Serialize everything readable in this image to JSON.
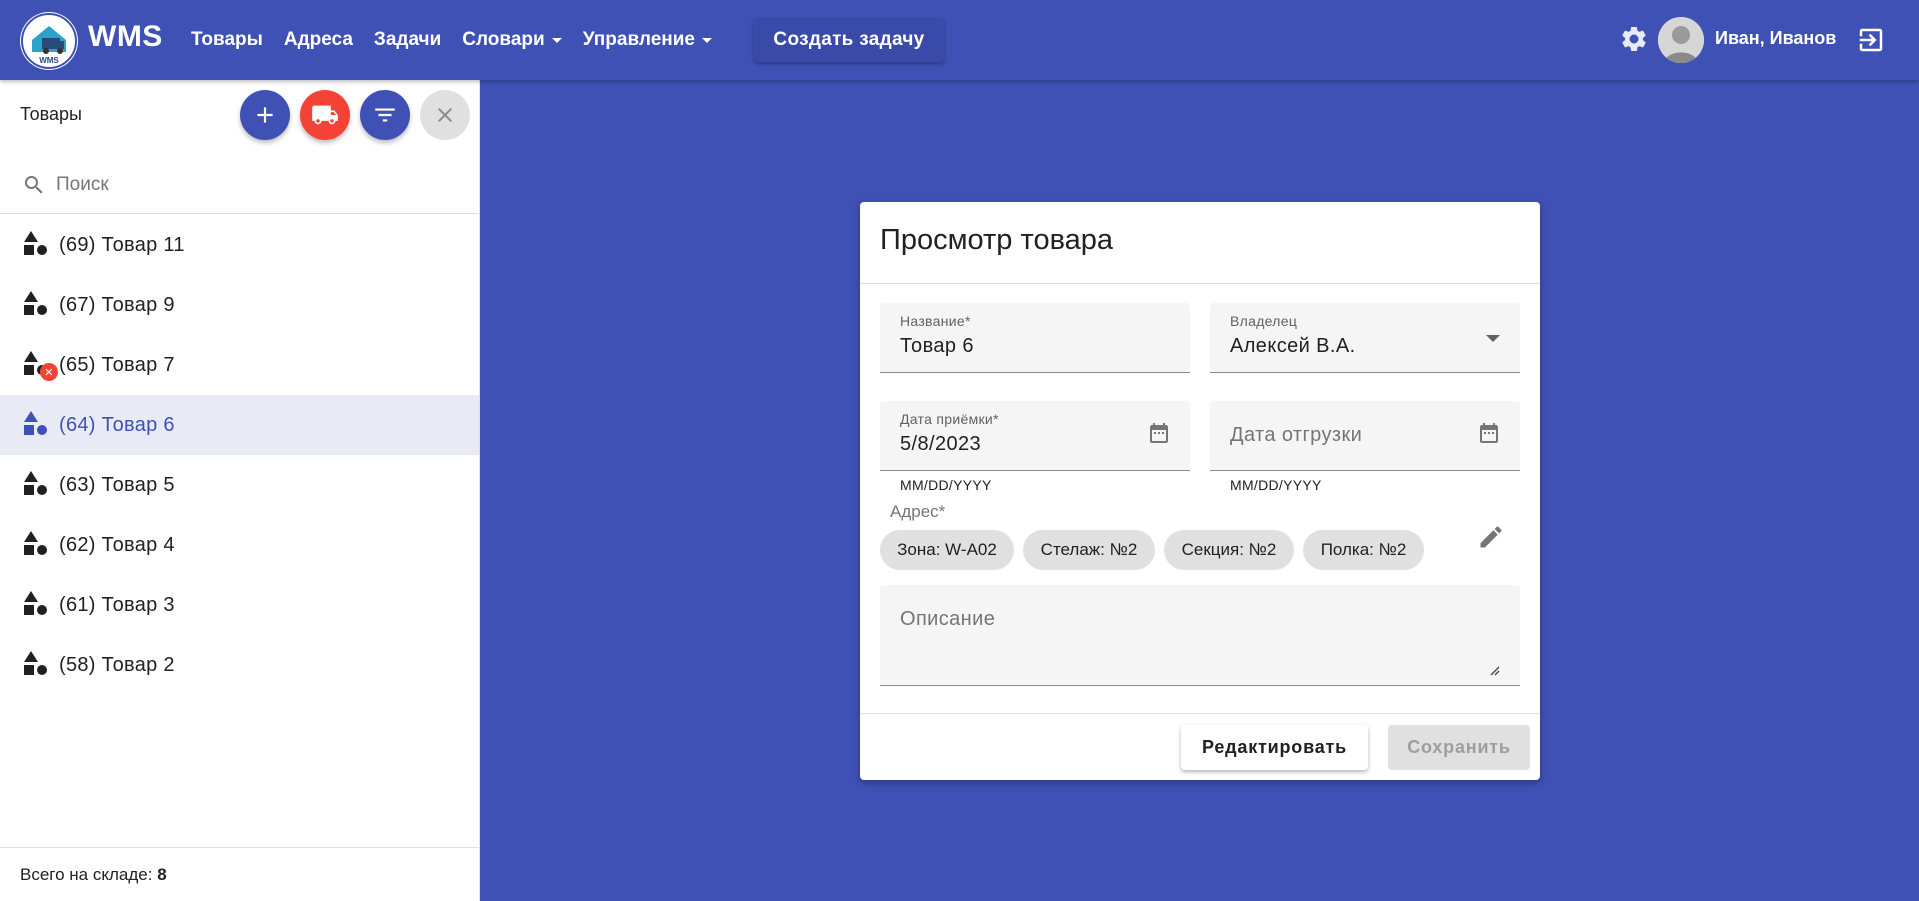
{
  "header": {
    "brand": "WMS",
    "logo_text": "WMS",
    "nav": [
      {
        "label": "Товары",
        "dropdown": false
      },
      {
        "label": "Адреса",
        "dropdown": false
      },
      {
        "label": "Задачи",
        "dropdown": false
      },
      {
        "label": "Словари",
        "dropdown": true
      },
      {
        "label": "Управление",
        "dropdown": true
      }
    ],
    "create_task_label": "Создать задачу",
    "settings_icon": "gear-icon",
    "user_name": "Иван, Иванов",
    "logout_icon": "logout-icon"
  },
  "sidebar": {
    "title": "Товары",
    "actions": [
      "add-icon",
      "truck-icon",
      "filter-icon",
      "close-icon"
    ],
    "search_placeholder": "Поиск",
    "items": [
      {
        "label": "(69)  Товар 11",
        "error": false,
        "active": false
      },
      {
        "label": "(67)  Товар 9",
        "error": false,
        "active": false
      },
      {
        "label": "(65)  Товар 7",
        "error": true,
        "active": false
      },
      {
        "label": "(64)  Товар 6",
        "error": false,
        "active": true
      },
      {
        "label": "(63)  Товар 5",
        "error": false,
        "active": false
      },
      {
        "label": "(62)  Товар 4",
        "error": false,
        "active": false
      },
      {
        "label": "(61)  Товар 3",
        "error": false,
        "active": false
      },
      {
        "label": "(58)  Товар 2",
        "error": false,
        "active": false
      }
    ],
    "footer_label": "Всего на складе: ",
    "footer_count": "8"
  },
  "card": {
    "title": "Просмотр товара",
    "name_label": "Название*",
    "name_value": "Товар 6",
    "owner_label": "Владелец",
    "owner_value": "Алексей В.А.",
    "receipt_label": "Дата приёмки*",
    "receipt_value": "5/8/2023",
    "receipt_hint": "MM/DD/YYYY",
    "shipment_placeholder": "Дата отгрузки",
    "shipment_hint": "MM/DD/YYYY",
    "address_label": "Адрес*",
    "address_chips": [
      "Зона: W-A02",
      "Стелаж: №2",
      "Секция: №2",
      "Полка: №2"
    ],
    "description_placeholder": "Описание",
    "edit_button": "Редактировать",
    "save_button": "Сохранить"
  },
  "colors": {
    "primary": "#3f51b5",
    "accent": "#f44336",
    "active_bg": "#e8eaf6"
  }
}
